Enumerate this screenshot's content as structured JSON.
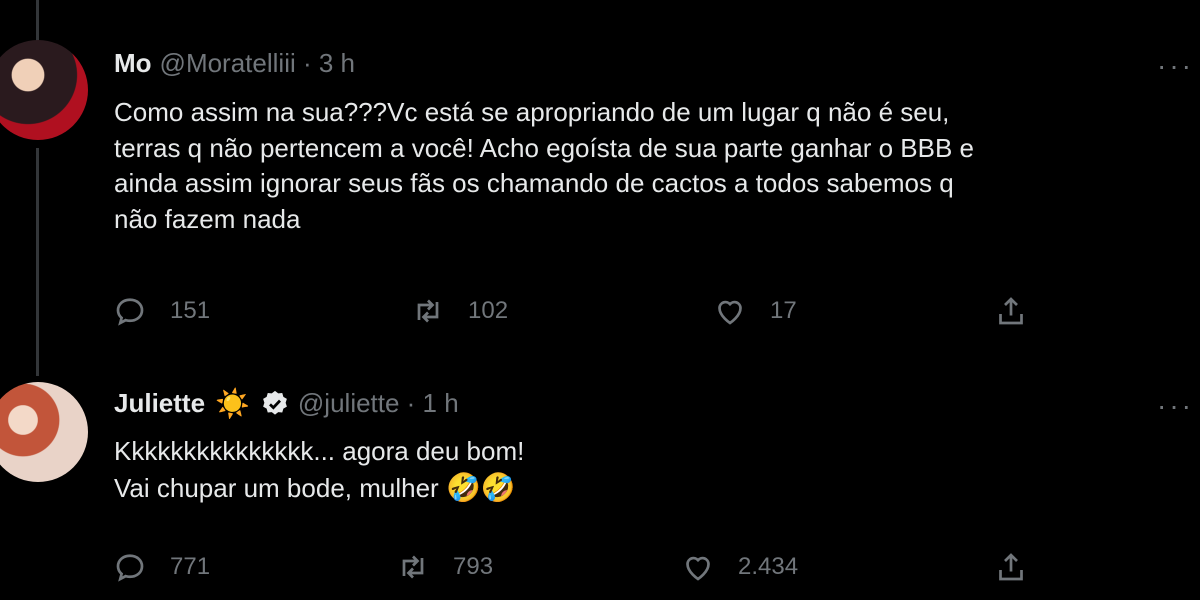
{
  "tweets": [
    {
      "name": "Mo",
      "handle": "@Moratelliii · 3 h",
      "text_lines": [
        "Como assim na sua???Vc está se apropriando de um lugar q não é seu,",
        "terras q não pertencem a você! Acho egoísta de sua parte ganhar o BBB e",
        "ainda assim ignorar seus fãs os chamando de cactos a todos sabemos q",
        "não fazem nada"
      ],
      "replies": "151",
      "retweets": "102",
      "likes": "17"
    },
    {
      "name": "Juliette",
      "name_emoji": "☀️",
      "handle": "@juliette · 1 h",
      "text_lines": [
        "Kkkkkkkkkkkkkkk... agora deu bom!",
        "Vai chupar um bode, mulher"
      ],
      "text_emoji": "🤣🤣",
      "replies": "771",
      "retweets": "793",
      "likes": "2.434"
    }
  ],
  "colors": {
    "background": "#000000",
    "text": "#e7e9ea",
    "muted": "#71767b",
    "thread_line": "#333639"
  },
  "icons": [
    "reply-icon",
    "retweet-icon",
    "like-icon",
    "share-icon",
    "more-icon",
    "verified-icon"
  ]
}
